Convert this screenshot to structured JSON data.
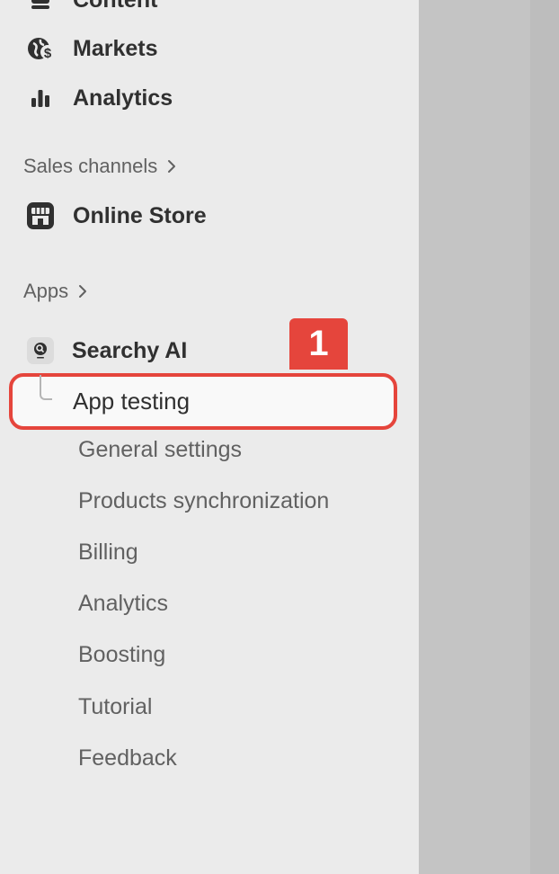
{
  "nav": {
    "content": {
      "label": "Content",
      "icon": "content-icon"
    },
    "markets": {
      "label": "Markets",
      "icon": "globe-dollar-icon"
    },
    "analytics": {
      "label": "Analytics",
      "icon": "bar-chart-icon"
    }
  },
  "sales_channels": {
    "heading": "Sales channels",
    "chevron": "chevron-right-icon",
    "items": [
      {
        "label": "Online Store",
        "icon": "store-icon"
      }
    ]
  },
  "apps": {
    "heading": "Apps",
    "chevron": "chevron-right-icon",
    "app": {
      "label": "Searchy AI",
      "icon": "searchy-ai-app-icon"
    },
    "subitems": [
      {
        "label": "App testing",
        "active": true
      },
      {
        "label": "General settings"
      },
      {
        "label": "Products synchronization"
      },
      {
        "label": "Billing"
      },
      {
        "label": "Analytics"
      },
      {
        "label": "Boosting"
      },
      {
        "label": "Tutorial"
      },
      {
        "label": "Feedback"
      }
    ]
  },
  "annotation": {
    "step_number": "1"
  },
  "colors": {
    "sidebar_bg": "#ebebeb",
    "content_overlay": "#c4c4c4",
    "annotation_red": "#e5453c",
    "text_primary": "#303030",
    "text_secondary": "#616161"
  }
}
